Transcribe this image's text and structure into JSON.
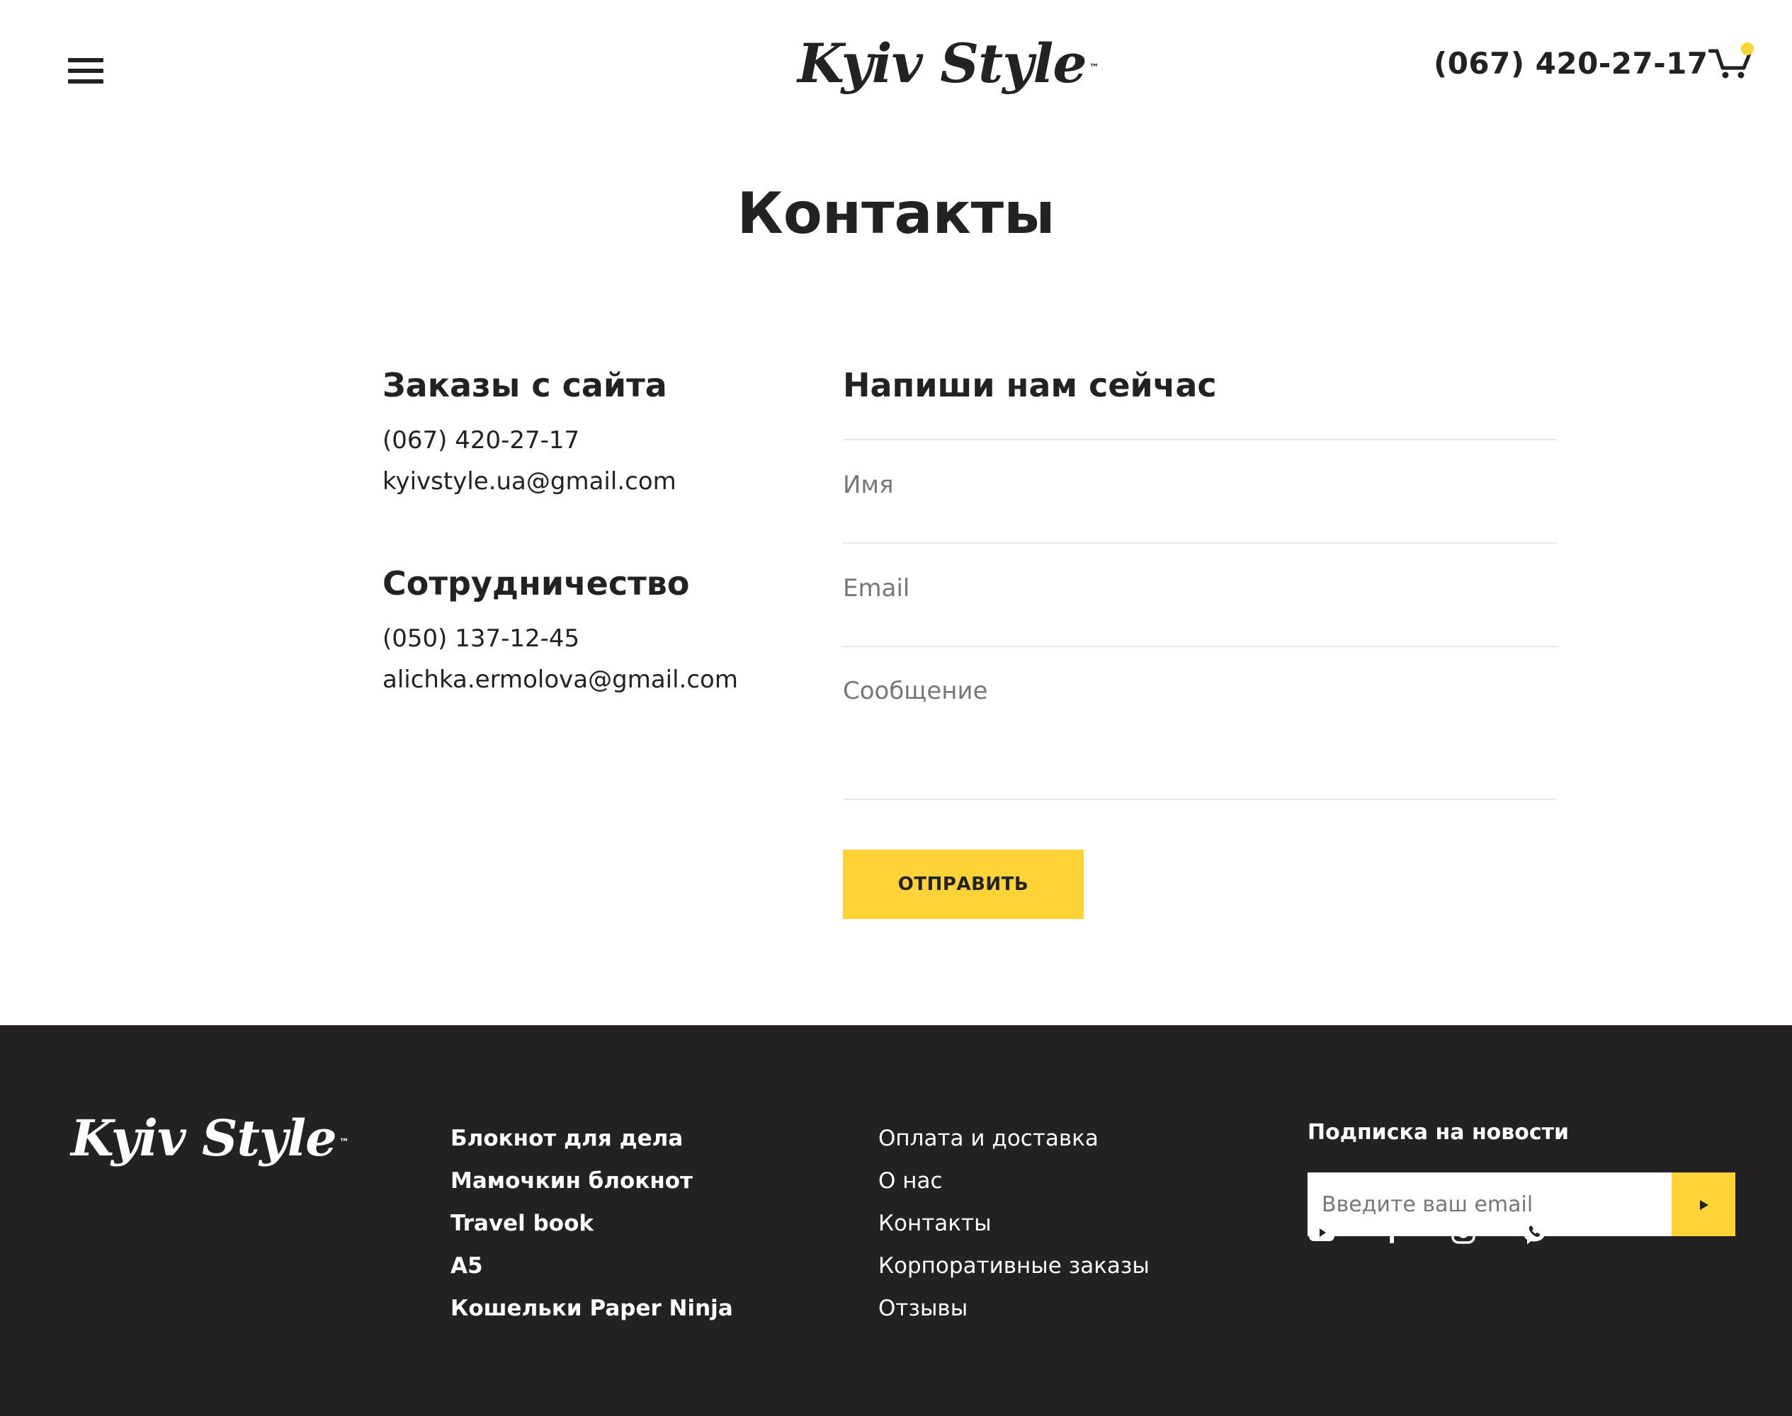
{
  "header": {
    "logo_text": "Kyiv Style",
    "logo_tm": "™",
    "phone": "(067) 420-27-17"
  },
  "main": {
    "title": "Контакты",
    "orders": {
      "title": "Заказы с сайта",
      "phone": "(067) 420-27-17",
      "email": "kyivstyle.ua@gmail.com"
    },
    "cooperation": {
      "title": "Сотрудничество",
      "phone": "(050) 137-12-45",
      "email": "alichka.ermolova@gmail.com"
    },
    "form": {
      "title": "Напиши нам сейчас",
      "name_placeholder": "Имя",
      "email_placeholder": "Email",
      "message_placeholder": "Сообщение",
      "submit_label": "ОТПРАВИТЬ"
    }
  },
  "footer": {
    "logo_text": "Kyiv Style",
    "logo_tm": "™",
    "products": [
      {
        "label": "Блокнот для дела"
      },
      {
        "label": "Мамочкин блокнот"
      },
      {
        "label": "Travel book"
      },
      {
        "label": "A5"
      },
      {
        "label": "Кошельки Paper Ninja"
      }
    ],
    "links": [
      {
        "label": "Оплата и доставка"
      },
      {
        "label": "О нас"
      },
      {
        "label": "Контакты"
      },
      {
        "label": "Корпоративные заказы"
      },
      {
        "label": "Отзывы"
      }
    ],
    "subscribe": {
      "title": "Подписка на новости",
      "placeholder": "Введите ваш email"
    },
    "social_icons": [
      "youtube-icon",
      "facebook-icon",
      "instagram-icon",
      "viber-icon"
    ]
  },
  "colors": {
    "accent": "#fdd335",
    "text": "#222222",
    "footer_bg": "#232122",
    "divider": "#e8e8e8"
  }
}
